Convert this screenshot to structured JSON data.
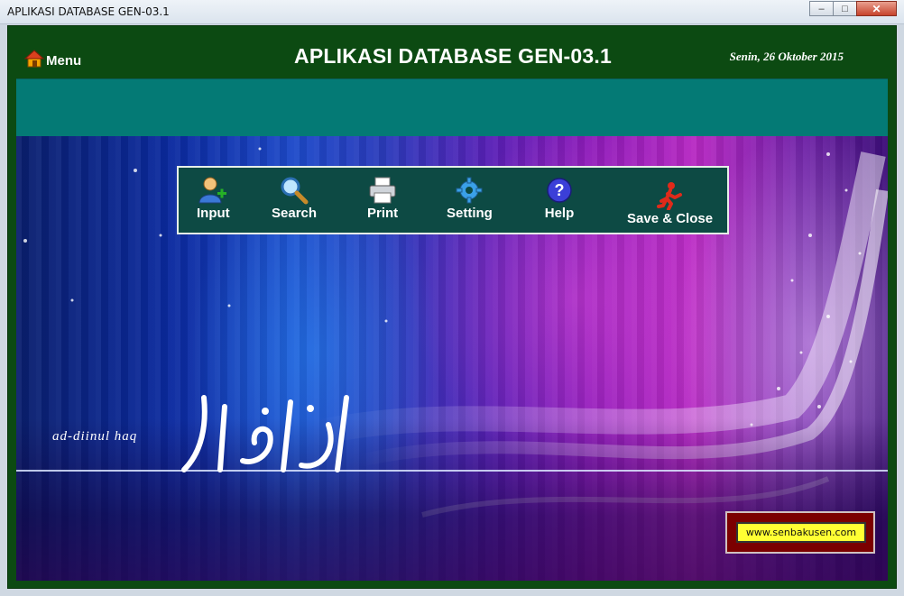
{
  "window": {
    "title": "APLIKASI DATABASE GEN-03.1",
    "minimize": "–",
    "maximize": "□",
    "close": "✕"
  },
  "header": {
    "menu_label": "Menu",
    "title": "APLIKASI DATABASE GEN-03.1",
    "date": "Senin, 26 Oktober 2015"
  },
  "toolbar": {
    "items": [
      {
        "label": "Input",
        "icon": "user-add-icon"
      },
      {
        "label": "Search",
        "icon": "magnifier-icon"
      },
      {
        "label": "Print",
        "icon": "printer-icon"
      },
      {
        "label": "Setting",
        "icon": "gear-icon"
      },
      {
        "label": "Help",
        "icon": "help-icon"
      },
      {
        "label": "Save & Close",
        "icon": "runner-exit-icon"
      }
    ]
  },
  "background": {
    "tagline": "ad-diinul haq"
  },
  "footer": {
    "website": "www.senbakusen.com"
  },
  "colors": {
    "frame": "#0c4a12",
    "teal_bar": "#047a75",
    "toolbar": "#0d4a44",
    "website_box": "#7b0000",
    "website_button": "#ffff33"
  }
}
